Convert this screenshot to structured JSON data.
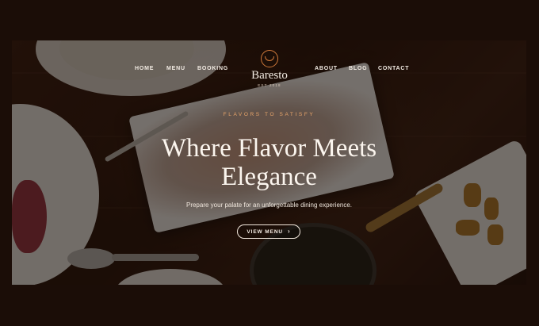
{
  "nav": {
    "left_items": [
      "HOME",
      "MENU",
      "BOOKING"
    ],
    "right_items": [
      "ABOUT",
      "BLOG",
      "CONTACT"
    ]
  },
  "logo": {
    "name": "Baresto",
    "tagline": "EST 2018",
    "icon": "serving-cloche-icon"
  },
  "hero": {
    "eyebrow": "FLAVORS TO SATISFY",
    "headline_line1": "Where Flavor Meets",
    "headline_line2": "Elegance",
    "subtitle": "Prepare your palate for an unforgettable dining experience.",
    "cta_label": "VIEW MENU",
    "cta_icon": "chevron-right-icon"
  },
  "colors": {
    "accent": "#e9a56a",
    "logo_accent": "#d07a3a",
    "page_background": "#1b0d07",
    "text": "#fbf5ee"
  }
}
